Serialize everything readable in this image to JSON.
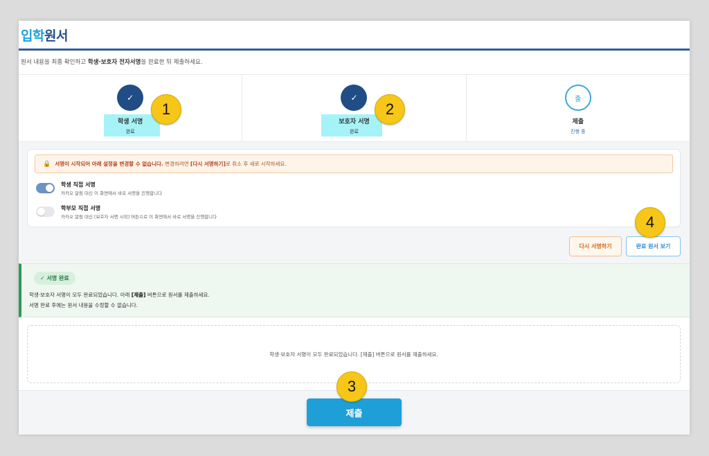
{
  "page": {
    "title_accent": "입학",
    "title_rest": "원서",
    "intro_pre": "원서 내용을 최종 확인하고 ",
    "intro_bold": "학생·보호자 전자서명",
    "intro_post": "을 완료한 뒤 제출하세요."
  },
  "steps": [
    {
      "label": "학생 서명",
      "status": "완료",
      "icon": "check-icon"
    },
    {
      "label": "보호자 서명",
      "status": "완료",
      "icon": "check-icon"
    },
    {
      "label": "제출",
      "status": "진행 중",
      "icon_text": "출"
    }
  ],
  "step_icon_glyph": "✓",
  "warning": {
    "icon": "lock-icon",
    "bold": "서명이 시작되어 아래 설정을 변경할 수 없습니다.",
    "text_mid": " 변경하려면 ",
    "bold2": "[다시 서명하기]",
    "text_end": "로 취소 후 새로 시작하세요."
  },
  "toggles": [
    {
      "title": "학생 직접 서명",
      "desc": "카카오 알림 대신 이 화면에서 바로 서명을 진행합니다",
      "on": true
    },
    {
      "title": "학부모 직접 서명",
      "desc": "카카오 알림 대신 [보호자 서명 시작] 버튼으로 이 화면에서 바로 서명을 진행합니다",
      "on": false
    }
  ],
  "buttons": {
    "resign": "다시 서명하기",
    "view": "완료 원서 보기",
    "submit": "제출"
  },
  "done": {
    "chip": "✓ 서명 완료",
    "line1_pre": "학생·보호자 서명이 모두 완료되었습니다. 아래 ",
    "line1_bold": "[제출]",
    "line1_post": " 버튼으로 원서를 제출하세요.",
    "line2": "서명 완료 후에는 원서 내용을 수정할 수 없습니다."
  },
  "notice": "학생·보호자 서명이 모두 완료되었습니다. [제출] 버튼으로 원서를 제출하세요.",
  "annotations": [
    "1",
    "2",
    "3",
    "4"
  ],
  "colors": {
    "primary": "#214d86",
    "accent": "#1e9fd8",
    "highlight": "#a6f3f7",
    "badge": "#f6c619",
    "success": "#2c9a55",
    "warning": "#b1421c"
  }
}
